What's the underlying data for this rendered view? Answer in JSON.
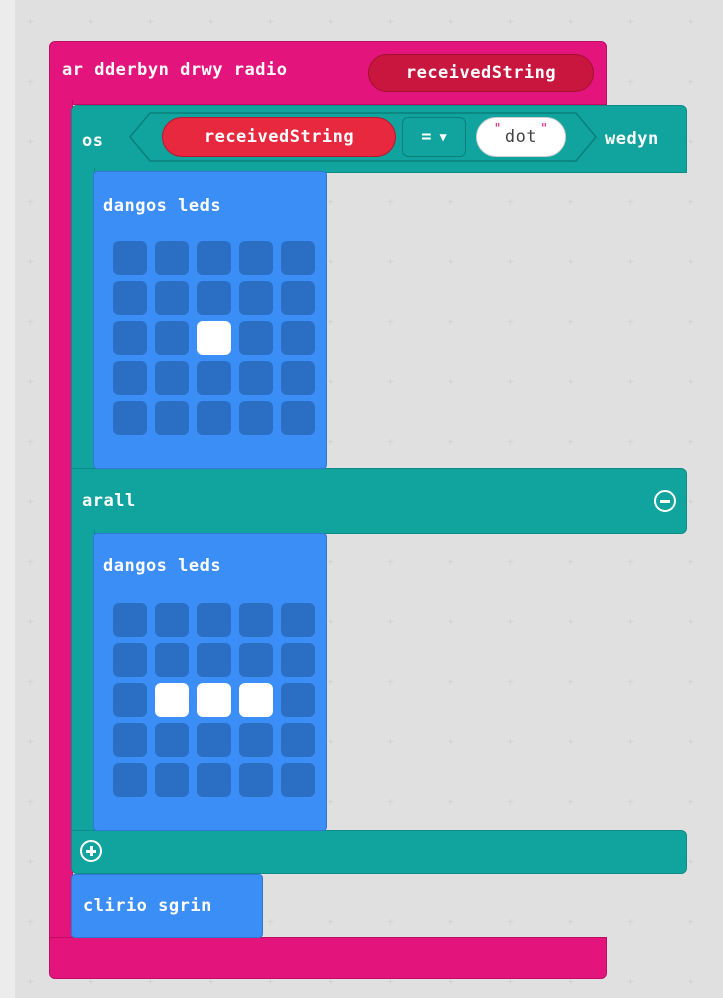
{
  "event_block": {
    "label": "ar dderbyn drwy radio",
    "param": "receivedString"
  },
  "if_block": {
    "if_label": "os",
    "then_label": "wedyn",
    "else_label": "arall",
    "condition": {
      "left": "receivedString",
      "operator": "=",
      "right": "dot"
    }
  },
  "show_leds_1": {
    "label": "dangos leds",
    "leds": [
      [
        0,
        0,
        0,
        0,
        0
      ],
      [
        0,
        0,
        0,
        0,
        0
      ],
      [
        0,
        0,
        1,
        0,
        0
      ],
      [
        0,
        0,
        0,
        0,
        0
      ],
      [
        0,
        0,
        0,
        0,
        0
      ]
    ]
  },
  "show_leds_2": {
    "label": "dangos leds",
    "leds": [
      [
        0,
        0,
        0,
        0,
        0
      ],
      [
        0,
        0,
        0,
        0,
        0
      ],
      [
        0,
        1,
        1,
        1,
        0
      ],
      [
        0,
        0,
        0,
        0,
        0
      ],
      [
        0,
        0,
        0,
        0,
        0
      ]
    ]
  },
  "clear_block": {
    "label": "clirio sgrin"
  },
  "colors": {
    "event": "#e3147c",
    "logic": "#11a49f",
    "basic": "#3a8ef5",
    "variable": "#c8163f"
  }
}
